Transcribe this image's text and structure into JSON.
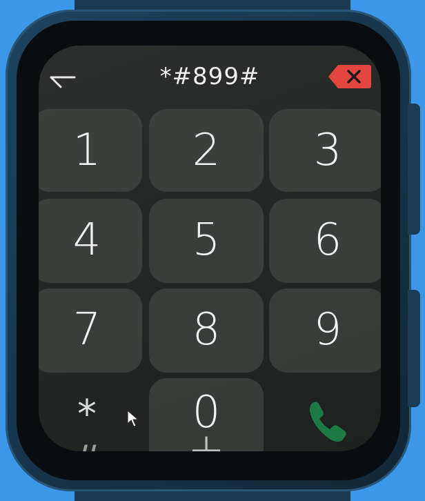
{
  "dialer": {
    "display": "*#899#",
    "keys": [
      {
        "digit": "1"
      },
      {
        "digit": "2"
      },
      {
        "digit": "3"
      },
      {
        "digit": "4"
      },
      {
        "digit": "5"
      },
      {
        "digit": "6"
      },
      {
        "digit": "7"
      },
      {
        "digit": "8"
      },
      {
        "digit": "9"
      }
    ],
    "star": {
      "symbol": "*",
      "sub": "#"
    },
    "zero": {
      "digit": "0",
      "sub": "+"
    }
  },
  "icons": {
    "back": "back-arrow-icon",
    "delete": "backspace-icon",
    "call": "phone-call-icon",
    "pointer": "mouse-pointer-icon"
  },
  "colors": {
    "delete_badge": "#e2463f",
    "call_green": "#1f8a4a",
    "background": "#3d97e8",
    "watch_case": "#1b3a52"
  }
}
